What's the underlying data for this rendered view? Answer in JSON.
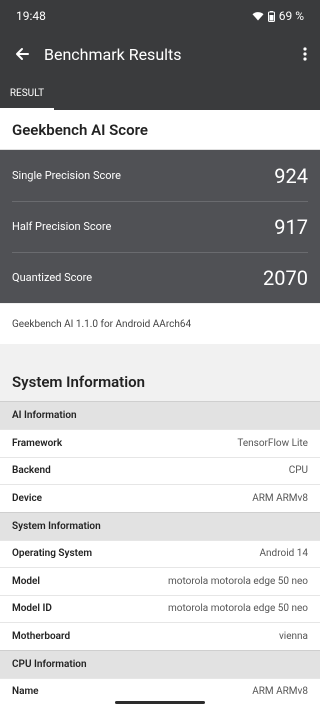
{
  "status": {
    "time": "19:48",
    "battery": "69 %"
  },
  "app_bar": {
    "title": "Benchmark Results"
  },
  "tabs": [
    {
      "label": "RESULT"
    }
  ],
  "score": {
    "header": "Geekbench AI Score",
    "items": [
      {
        "label": "Single Precision Score",
        "value": "924"
      },
      {
        "label": "Half Precision Score",
        "value": "917"
      },
      {
        "label": "Quantized Score",
        "value": "2070"
      }
    ],
    "version": "Geekbench AI 1.1.0 for Android AArch64"
  },
  "system_info": {
    "title": "System Information",
    "sections": [
      {
        "name": "AI Information",
        "rows": [
          {
            "k": "Framework",
            "v": "TensorFlow Lite"
          },
          {
            "k": "Backend",
            "v": "CPU"
          },
          {
            "k": "Device",
            "v": "ARM ARMv8"
          }
        ]
      },
      {
        "name": "System Information",
        "rows": [
          {
            "k": "Operating System",
            "v": "Android 14"
          },
          {
            "k": "Model",
            "v": "motorola motorola edge 50 neo"
          },
          {
            "k": "Model ID",
            "v": "motorola motorola edge 50 neo"
          },
          {
            "k": "Motherboard",
            "v": "vienna"
          }
        ]
      },
      {
        "name": "CPU Information",
        "rows": [
          {
            "k": "Name",
            "v": "ARM ARMv8"
          }
        ]
      }
    ]
  }
}
